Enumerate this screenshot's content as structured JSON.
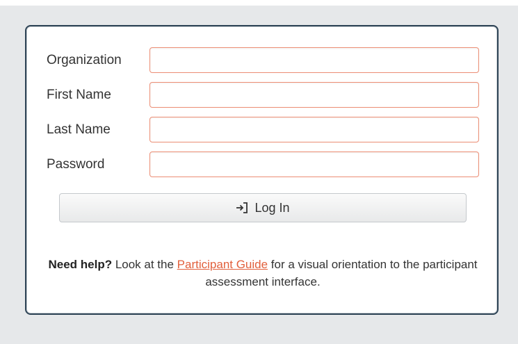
{
  "form": {
    "fields": [
      {
        "label": "Organization",
        "value": "",
        "placeholder": ""
      },
      {
        "label": "First Name",
        "value": "",
        "placeholder": ""
      },
      {
        "label": "Last Name",
        "value": "",
        "placeholder": ""
      },
      {
        "label": "Password",
        "value": "",
        "placeholder": ""
      }
    ],
    "login_label": "Log In",
    "login_icon": "sign-in-icon"
  },
  "help": {
    "bold": "Need help?",
    "before_link": " Look at the ",
    "link": "Participant Guide",
    "after_link": " for a visual orientation to the participant assessment interface."
  },
  "colors": {
    "page_background": "#e6e8ea",
    "card_border": "#2d4355",
    "input_border": "#ec8d74",
    "link": "#e2603c"
  }
}
